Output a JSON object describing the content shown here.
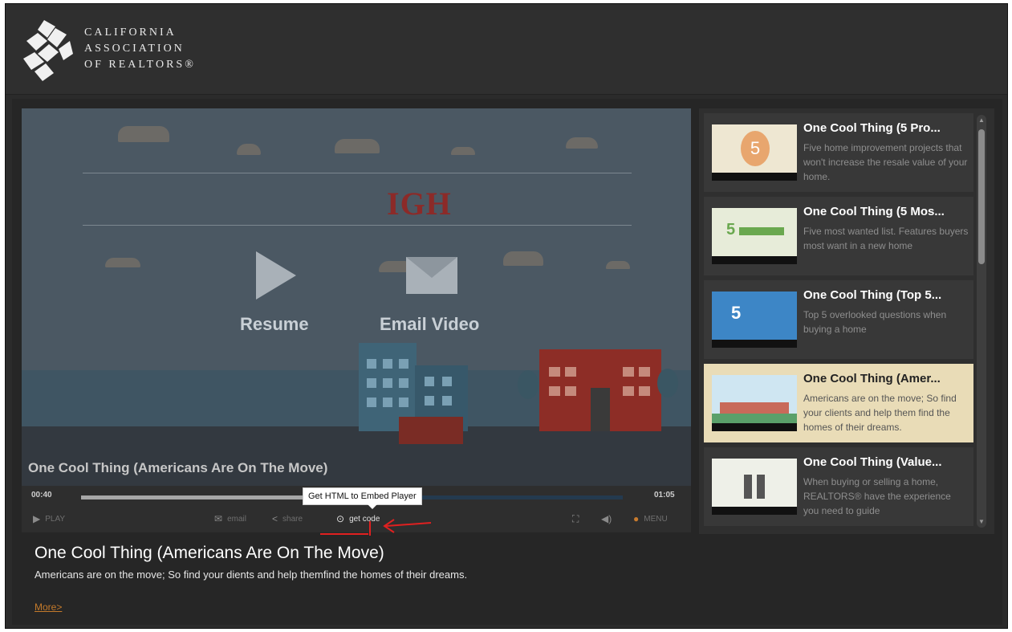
{
  "brand": {
    "line1": "CALIFORNIA",
    "line2": "ASSOCIATION",
    "line3": "OF REALTORS®"
  },
  "video": {
    "scene_text": "IGH",
    "resume_label": "Resume",
    "email_video_label": "Email Video",
    "title_overlay": "One Cool Thing (Americans Are On The Move)"
  },
  "controls": {
    "current_time": "00:40",
    "total_time": "01:05",
    "progress": 0.45,
    "play_label": "PLAY",
    "email_label": "email",
    "share_label": "share",
    "get_code_label": "get code",
    "menu_label": "MENU",
    "tooltip": "Get HTML to Embed Player"
  },
  "description": {
    "title": "One Cool Thing (Americans Are On The Move)",
    "text": "Americans are on the move; So find your dients and help themfind the homes of their dreams.",
    "more_link": "More>"
  },
  "playlist": {
    "items": [
      {
        "title": "One Cool Thing (5 Pro...",
        "desc": "Five home improvement projects that won't increase the resale value of your home.",
        "thumb_text": "5",
        "selected": false
      },
      {
        "title": "One Cool Thing (5 Mos...",
        "desc": "Five most wanted list. Features buyers most want in a new home",
        "thumb_text": "5",
        "selected": false
      },
      {
        "title": "One Cool Thing (Top 5...",
        "desc": "Top 5 overlooked questions when buying a home",
        "thumb_text": "5",
        "selected": false
      },
      {
        "title": "One Cool Thing (Amer...",
        "desc": "Americans are on the move; So find your clients and help them find the homes of their dreams.",
        "thumb_text": "",
        "selected": true
      },
      {
        "title": "One Cool Thing (Value...",
        "desc": "When buying or selling a home, REALTORS® have the experience you need to guide",
        "thumb_text": "",
        "selected": false
      }
    ]
  },
  "colors": {
    "accent_link": "#c47a2b",
    "selected_item": "#e9dcb7",
    "annotation_red": "#e02020"
  }
}
